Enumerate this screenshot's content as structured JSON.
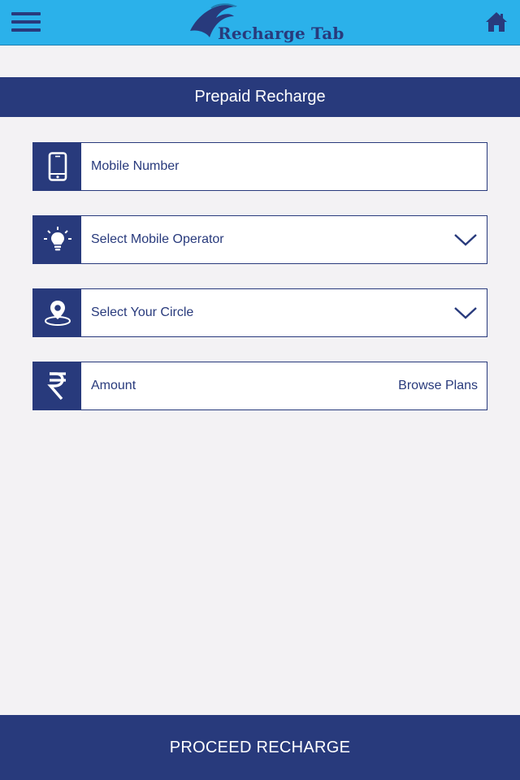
{
  "header": {
    "logo_text": "Recharge Tab",
    "brand_color": "#2bb1ea",
    "accent_color": "#283a7c",
    "menu_icon": "hamburger-menu-icon",
    "home_icon": "home-icon"
  },
  "section": {
    "title": "Prepaid Recharge"
  },
  "form": {
    "mobile_number": {
      "placeholder": "Mobile Number",
      "icon": "mobile-phone-icon"
    },
    "operator": {
      "placeholder": "Select Mobile Operator",
      "icon": "lightbulb-icon"
    },
    "circle": {
      "placeholder": "Select Your Circle",
      "icon": "location-pin-icon"
    },
    "amount": {
      "placeholder": "Amount",
      "icon": "rupee-icon",
      "browse_label": "Browse Plans"
    }
  },
  "footer": {
    "proceed_label": "PROCEED RECHARGE"
  }
}
